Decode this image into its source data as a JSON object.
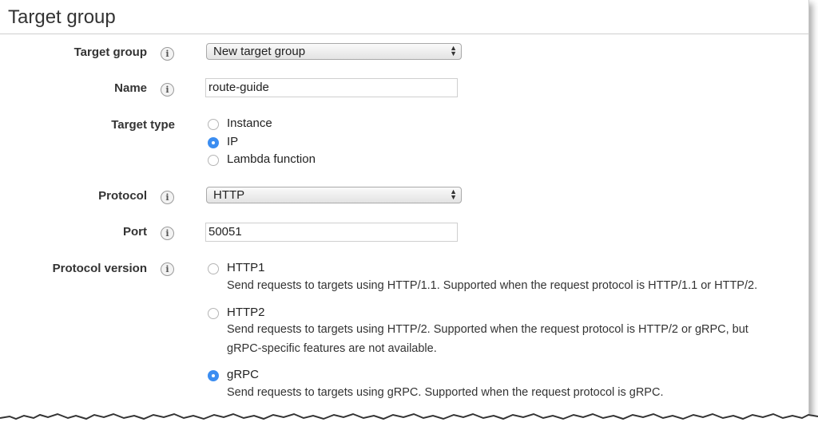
{
  "section_title": "Target group",
  "rows": {
    "target_group": {
      "label": "Target group",
      "value": "New target group"
    },
    "name": {
      "label": "Name",
      "value": "route-guide"
    },
    "target_type": {
      "label": "Target type",
      "options": [
        "Instance",
        "IP",
        "Lambda function"
      ],
      "selected": "IP"
    },
    "protocol": {
      "label": "Protocol",
      "value": "HTTP"
    },
    "port": {
      "label": "Port",
      "value": "50051"
    },
    "protocol_version": {
      "label": "Protocol version",
      "options": [
        {
          "label": "HTTP1",
          "description": "Send requests to targets using HTTP/1.1. Supported when the request protocol is HTTP/1.1 or HTTP/2."
        },
        {
          "label": "HTTP2",
          "description_line1": "Send requests to targets using HTTP/2. Supported when the request protocol is HTTP/2 or gRPC, but",
          "description_line2": "gRPC-specific features are not available."
        },
        {
          "label": "gRPC",
          "description": "Send requests to targets using gRPC. Supported when the request protocol is gRPC."
        }
      ],
      "selected": "gRPC"
    }
  },
  "info_icon_glyph": "i",
  "icons": {
    "info": "info-icon",
    "select_arrows": "select-arrows-icon"
  },
  "colors": {
    "radio_selected": "#3b8df1",
    "title": "#333333"
  }
}
